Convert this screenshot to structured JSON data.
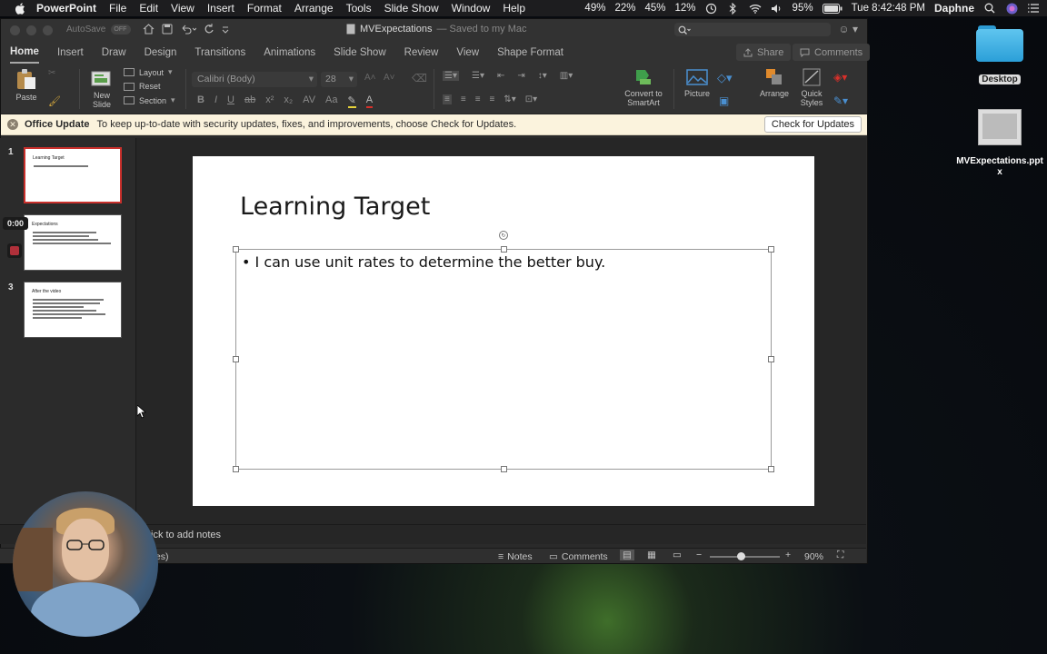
{
  "menubar": {
    "app_name": "PowerPoint",
    "items": [
      "File",
      "Edit",
      "View",
      "Insert",
      "Format",
      "Arrange",
      "Tools",
      "Slide Show",
      "Window",
      "Help"
    ],
    "stats": [
      "49%",
      "22%",
      "45%",
      "12%"
    ],
    "battery": "95%",
    "datetime": "Tue 8:42:48 PM",
    "user": "Daphne"
  },
  "titlebar": {
    "autosave": "AutoSave",
    "autosave_state": "OFF",
    "doc_name": "MVExpectations",
    "doc_status": "— Saved to my Mac"
  },
  "tabs": [
    "Home",
    "Insert",
    "Draw",
    "Design",
    "Transitions",
    "Animations",
    "Slide Show",
    "Review",
    "View",
    "Shape Format"
  ],
  "share_label": "Share",
  "comments_label": "Comments",
  "ribbon": {
    "paste": "Paste",
    "new_slide": "New\nSlide",
    "layout": "Layout",
    "reset": "Reset",
    "section": "Section",
    "font_name": "Calibri (Body)",
    "font_size": "28",
    "convert": "Convert to\nSmartArt",
    "picture": "Picture",
    "arrange": "Arrange",
    "quick_styles": "Quick\nStyles"
  },
  "update_bar": {
    "title": "Office Update",
    "message": "To keep up-to-date with security updates, fixes, and improvements, choose Check for Updates.",
    "button": "Check for Updates"
  },
  "slides": [
    {
      "num": "1",
      "title": "Learning Target"
    },
    {
      "num": "2",
      "title": "Expectations"
    },
    {
      "num": "3",
      "title": "After the video"
    }
  ],
  "timer": "0:00",
  "slide": {
    "title": "Learning Target",
    "bullet": "I can use unit rates to determine the better buy."
  },
  "notes_hint": "ick to add notes",
  "status": {
    "left": "tes)",
    "notes": "Notes",
    "comments": "Comments",
    "zoom": "90%"
  },
  "desktop": {
    "folder_label": "Desktop",
    "file_label": "MVExpectations.pptx"
  }
}
